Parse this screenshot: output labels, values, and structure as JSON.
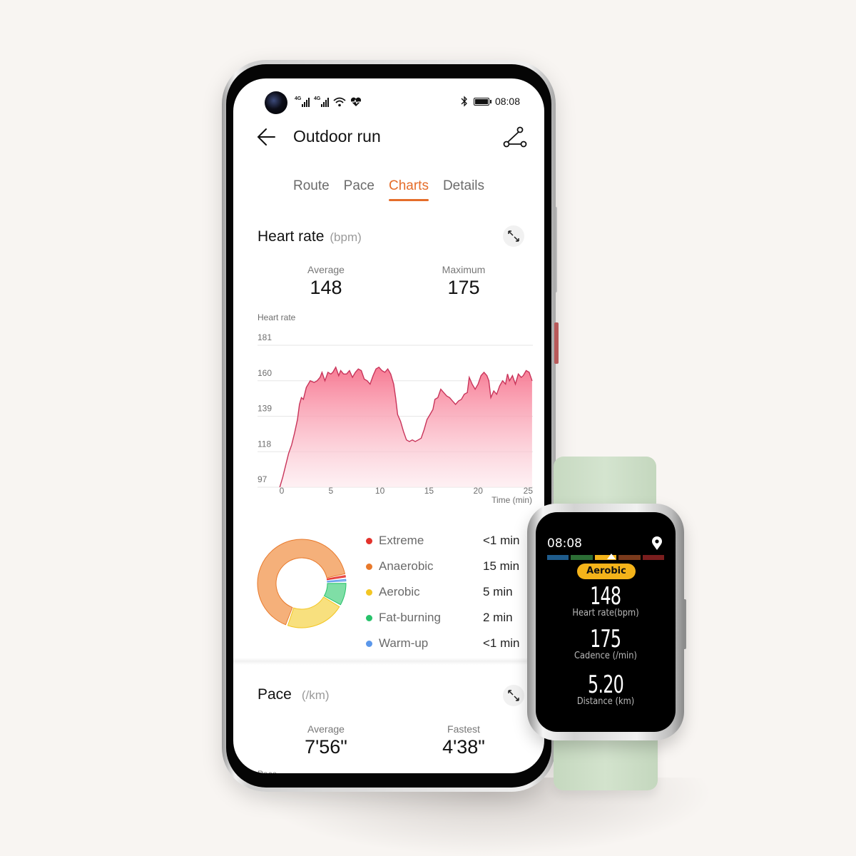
{
  "status_bar": {
    "network_1": "4G",
    "network_2": "4G",
    "time": "08:08",
    "icons": [
      "camera-hole",
      "signal-icon",
      "signal-icon",
      "wifi-icon",
      "health-heart-icon",
      "bluetooth-icon",
      "battery-icon"
    ]
  },
  "header": {
    "title": "Outdoor run",
    "back_icon": "arrow-left-icon",
    "route_icon": "route-path-icon"
  },
  "tabs": [
    {
      "label": "Route",
      "active": false
    },
    {
      "label": "Pace",
      "active": false
    },
    {
      "label": "Charts",
      "active": true
    },
    {
      "label": "Details",
      "active": false
    }
  ],
  "colors": {
    "accent": "#e56d2a",
    "hr_line": "#c8345a",
    "hr_fill": "#f7879c"
  },
  "heart_rate": {
    "title": "Heart rate",
    "unit": "(bpm)",
    "stats": [
      {
        "label": "Average",
        "value": "148"
      },
      {
        "label": "Maximum",
        "value": "175"
      }
    ]
  },
  "chart_data": {
    "type": "area",
    "title": "",
    "ylabel": "Heart rate",
    "xlabel": "Time (min)",
    "yticks": [
      181,
      160,
      139,
      118,
      97
    ],
    "xticks": [
      0,
      5,
      10,
      15,
      20,
      25
    ],
    "ylim": [
      97,
      181
    ],
    "xlim": [
      0,
      25
    ],
    "grid": true,
    "series": [
      {
        "name": "Heart rate",
        "x": [
          -0.2,
          0.1,
          0.4,
          0.7,
          1.0,
          1.3,
          1.6,
          1.8,
          2.0,
          2.2,
          2.5,
          2.9,
          3.3,
          3.6,
          3.9,
          4.1,
          4.4,
          4.7,
          5.0,
          5.2,
          5.5,
          5.8,
          6.0,
          6.3,
          6.6,
          6.9,
          7.2,
          7.5,
          7.8,
          8.1,
          8.4,
          8.7,
          9.0,
          9.3,
          9.6,
          9.9,
          10.2,
          10.5,
          10.8,
          11.1,
          11.4,
          11.6,
          11.8,
          12.1,
          12.4,
          12.7,
          13.0,
          13.3,
          13.6,
          13.9,
          14.2,
          14.5,
          14.8,
          15.1,
          15.4,
          15.6,
          15.9,
          16.2,
          16.5,
          16.8,
          17.1,
          17.4,
          17.7,
          18.0,
          18.3,
          18.6,
          18.9,
          19.1,
          19.4,
          19.7,
          20.0,
          20.3,
          20.6,
          20.9,
          21.1,
          21.3,
          21.6,
          21.9,
          22.2,
          22.5,
          22.8,
          23.0,
          23.2,
          23.5,
          23.8,
          24.1,
          24.4,
          24.6,
          24.9,
          25.2,
          25.5
        ],
        "y": [
          97,
          103,
          110,
          117,
          122,
          129,
          137,
          146,
          150,
          149,
          156,
          160,
          159,
          160,
          162,
          165,
          160,
          165,
          164,
          165,
          168,
          163,
          166,
          164,
          164,
          166,
          162,
          165,
          167,
          166,
          161,
          160,
          158,
          163,
          167,
          168,
          166,
          165,
          167,
          164,
          158,
          150,
          140,
          136,
          130,
          125,
          124,
          125,
          124,
          125,
          126,
          131,
          137,
          140,
          143,
          149,
          150,
          155,
          153,
          151,
          150,
          148,
          146,
          148,
          149,
          152,
          153,
          162,
          158,
          155,
          158,
          163,
          165,
          163,
          160,
          150,
          154,
          152,
          157,
          160,
          158,
          164,
          160,
          163,
          158,
          164,
          162,
          163,
          166,
          165,
          160
        ]
      }
    ]
  },
  "zones": {
    "items": [
      {
        "name": "Extreme",
        "value": "<1 min",
        "color": "#e3322b",
        "fill": "#ef5c5c",
        "minutes": 0.3
      },
      {
        "name": "Anaerobic",
        "value": "15 min",
        "color": "#e8792b",
        "fill": "#f5b07a",
        "minutes": 15
      },
      {
        "name": "Aerobic",
        "value": "5 min",
        "color": "#f3c623",
        "fill": "#f8e07e",
        "minutes": 5
      },
      {
        "name": "Fat-burning",
        "value": "2 min",
        "color": "#27c26a",
        "fill": "#7fdea6",
        "minutes": 2
      },
      {
        "name": "Warm-up",
        "value": "<1 min",
        "color": "#5b97ea",
        "fill": "#9cc2f3",
        "minutes": 0.3
      }
    ]
  },
  "pace": {
    "title": "Pace",
    "unit": "(/km)",
    "stats": [
      {
        "label": "Average",
        "value": "7'56\""
      },
      {
        "label": "Fastest",
        "value": "4'38\""
      }
    ],
    "chart_label": "Pace"
  },
  "watch": {
    "time": "08:08",
    "zone_badge": "Aerobic",
    "zone_colors": [
      "#1f5c8c",
      "#2c6e35",
      "#f4b31a",
      "#7a3a1c",
      "#7a1e1e"
    ],
    "metrics": [
      {
        "value": "148",
        "label": "Heart rate(bpm)"
      },
      {
        "value": "175",
        "label": "Cadence (/min)"
      },
      {
        "value": "5.20",
        "label": "Distance (km)"
      }
    ]
  }
}
